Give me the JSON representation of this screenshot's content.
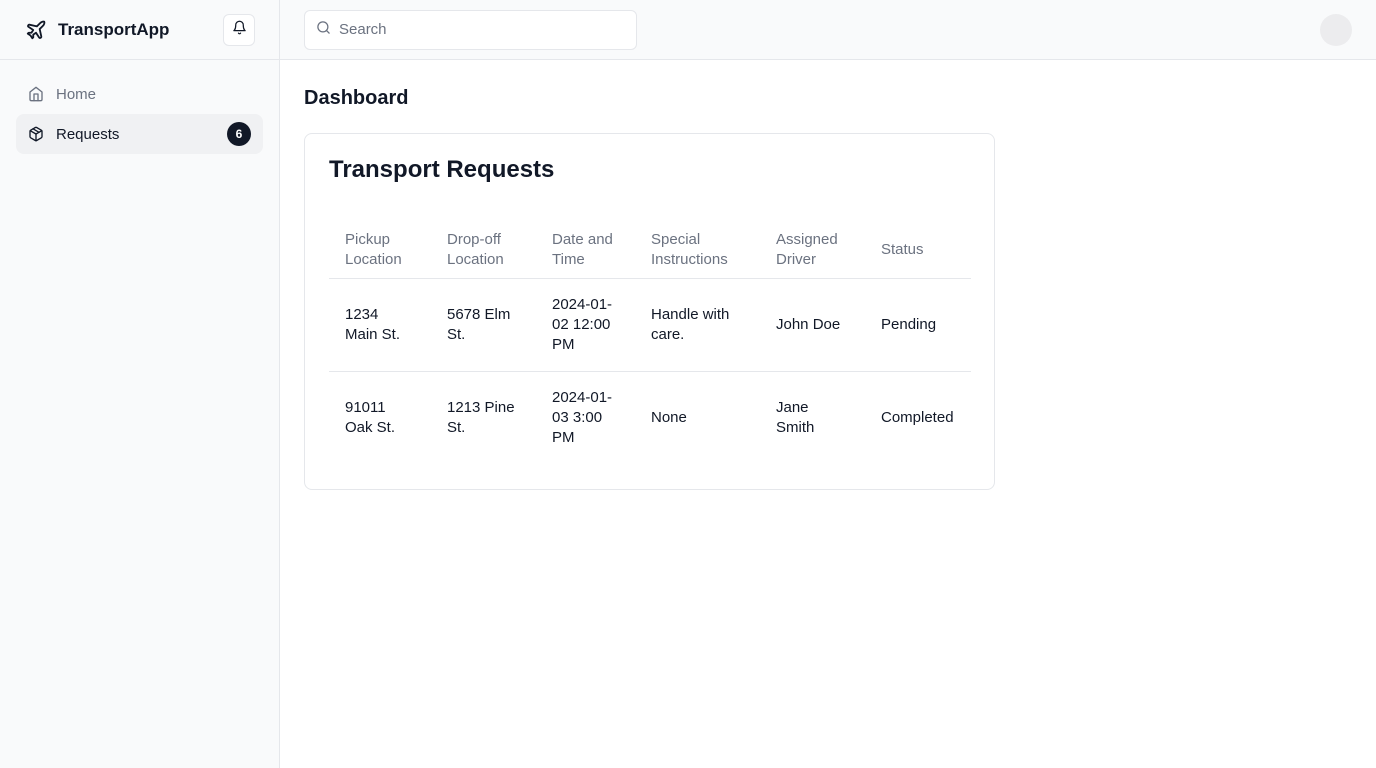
{
  "app": {
    "name": "TransportApp"
  },
  "sidebar": {
    "items": [
      {
        "label": "Home",
        "icon": "home-icon",
        "active": false
      },
      {
        "label": "Requests",
        "icon": "package-icon",
        "active": true,
        "badge": "6"
      }
    ]
  },
  "header": {
    "search": {
      "placeholder": "Search",
      "value": ""
    }
  },
  "main": {
    "page_title": "Dashboard",
    "card": {
      "title": "Transport Requests",
      "table": {
        "columns": [
          "Pickup Location",
          "Drop-off Location",
          "Date and Time",
          "Special Instructions",
          "Assigned Driver",
          "Status"
        ],
        "rows": [
          [
            "1234 Main St.",
            "5678 Elm St.",
            "2024-01-02 12:00 PM",
            "Handle with care.",
            "John Doe",
            "Pending"
          ],
          [
            "91011 Oak St.",
            "1213 Pine St.",
            "2024-01-03 3:00 PM",
            "None",
            "Jane Smith",
            "Completed"
          ]
        ]
      }
    }
  },
  "colors": {
    "sidebar_bg": "#f9fafb",
    "border": "#e5e7eb",
    "muted_text": "#6b7280",
    "primary_text": "#111827",
    "badge_bg": "#111827"
  }
}
